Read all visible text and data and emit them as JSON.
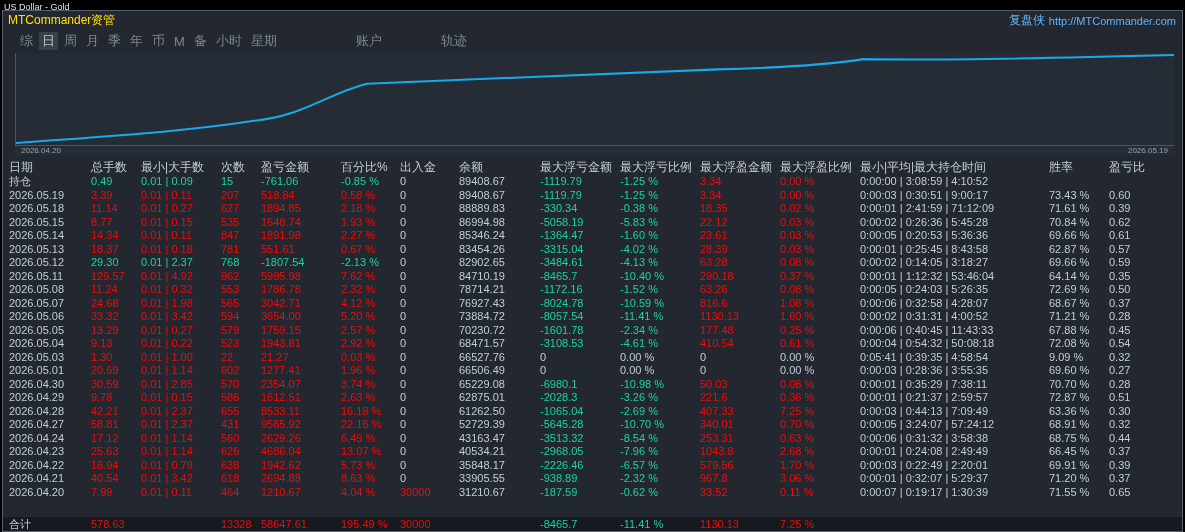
{
  "window": {
    "title": "US Dollar - Gold"
  },
  "header": {
    "brand": "MTCommander资管",
    "product": "复盘侠",
    "url": "http://MTCommander.com"
  },
  "tabs": [
    {
      "label": "综",
      "selected": false
    },
    {
      "label": "日",
      "selected": true
    },
    {
      "label": "周",
      "selected": false
    },
    {
      "label": "月",
      "selected": false
    },
    {
      "label": "季",
      "selected": false
    },
    {
      "label": "年",
      "selected": false
    },
    {
      "label": "币",
      "selected": false
    },
    {
      "label": "M",
      "selected": false
    },
    {
      "label": "备",
      "selected": false
    },
    {
      "label": "小时",
      "selected": false
    },
    {
      "label": "星期",
      "selected": false
    },
    {
      "label": "账户",
      "selected": false
    },
    {
      "label": "轨迹",
      "selected": false
    }
  ],
  "chart": {
    "start_label": "2026.04.20",
    "end_label": "2026.05.19"
  },
  "table": {
    "columns": [
      "日期",
      "总手数",
      "最小|大手数",
      "次数",
      "盈亏金额",
      "百分比%",
      "出入金",
      "余额",
      "最大浮亏金额",
      "最大浮亏比例",
      "最大浮盈金额",
      "最大浮盈比例",
      "最小|平均|最大持仓时间",
      "胜率",
      "盈亏比"
    ],
    "rows": [
      {
        "loss": true,
        "flat": false,
        "deposit": false,
        "cells": [
          "持仓",
          "0.49",
          "0.01 | 0.09",
          "15",
          "-761.06",
          "-0.85 %",
          "0",
          "89408.67",
          "-1119.79",
          "-1.25 %",
          "3.34",
          "0.00 %",
          "0:00:00 | 3:08:59 | 4:10:52"
        ]
      },
      {
        "loss": false,
        "flat": false,
        "deposit": false,
        "cells": [
          "2026.05.19",
          "3.39",
          "0.01 | 0.11",
          "207",
          "518.84",
          "0.58 %",
          "0",
          "89408.67",
          "-1119.79",
          "-1.25 %",
          "3.34",
          "0.00 %",
          "0:00:03 | 0:30:51 | 9:00:17",
          "73.43 %",
          "0.60"
        ]
      },
      {
        "loss": false,
        "flat": false,
        "deposit": false,
        "cells": [
          "2026.05.18",
          "11.14",
          "0.01 | 0.27",
          "627",
          "1894.85",
          "2.18 %",
          "0",
          "88889.83",
          "-330.34",
          "-0.38 %",
          "18.35",
          "0.02 %",
          "0:00:01 | 2:41:59 | 71:12:09",
          "71.61 %",
          "0.39"
        ]
      },
      {
        "loss": false,
        "flat": false,
        "deposit": false,
        "cells": [
          "2026.05.15",
          "8.77",
          "0.01 | 0.15",
          "535",
          "1648.74",
          "1.93 %",
          "0",
          "86994.98",
          "-5058.19",
          "-5.83 %",
          "22.12",
          "0.03 %",
          "0:00:02 | 0:26:36 | 5:45:28",
          "70.84 %",
          "0.62"
        ]
      },
      {
        "loss": false,
        "flat": false,
        "deposit": false,
        "cells": [
          "2026.05.14",
          "14.34",
          "0.01 | 0.11",
          "847",
          "1891.98",
          "2.27 %",
          "0",
          "85346.24",
          "-1364.47",
          "-1.60 %",
          "23.61",
          "0.03 %",
          "0:00:05 | 0:20:53 | 5:36:36",
          "69.66 %",
          "0.61"
        ]
      },
      {
        "loss": false,
        "flat": false,
        "deposit": false,
        "cells": [
          "2026.05.13",
          "18.37",
          "0.01 | 0.18",
          "781",
          "551.61",
          "0.67 %",
          "0",
          "83454.26",
          "-3315.04",
          "-4.02 %",
          "28.39",
          "0.03 %",
          "0:00:01 | 0:25:45 | 8:43:58",
          "62.87 %",
          "0.57"
        ]
      },
      {
        "loss": true,
        "flat": false,
        "deposit": false,
        "cells": [
          "2026.05.12",
          "29.30",
          "0.01 | 2.37",
          "768",
          "-1807.54",
          "-2.13 %",
          "0",
          "82902.65",
          "-3484.61",
          "-4.13 %",
          "63.28",
          "0.08 %",
          "0:00:02 | 0:14:05 | 3:18:27",
          "69.66 %",
          "0.59"
        ]
      },
      {
        "loss": false,
        "flat": false,
        "deposit": false,
        "cells": [
          "2026.05.11",
          "129.57",
          "0.01 | 4.92",
          "962",
          "5995.98",
          "7.62 %",
          "0",
          "84710.19",
          "-8465.7",
          "-10.40 %",
          "290.18",
          "0.37 %",
          "0:00:01 | 1:12:32 | 53:46:04",
          "64.14 %",
          "0.35"
        ]
      },
      {
        "loss": false,
        "flat": false,
        "deposit": false,
        "cells": [
          "2026.05.08",
          "11.24",
          "0.01 | 0.32",
          "553",
          "1786.78",
          "2.32 %",
          "0",
          "78714.21",
          "-1172.16",
          "-1.52 %",
          "63.26",
          "0.08 %",
          "0:00:05 | 0:24:03 | 5:26:35",
          "72.69 %",
          "0.50"
        ]
      },
      {
        "loss": false,
        "flat": false,
        "deposit": false,
        "cells": [
          "2026.05.07",
          "24.68",
          "0.01 | 1.98",
          "565",
          "3042.71",
          "4.12 %",
          "0",
          "76927.43",
          "-8024.78",
          "-10.59 %",
          "816.6",
          "1.08 %",
          "0:00:06 | 0:32:58 | 4:28:07",
          "68.67 %",
          "0.37"
        ]
      },
      {
        "loss": false,
        "flat": false,
        "deposit": false,
        "cells": [
          "2026.05.06",
          "33.32",
          "0.01 | 3.42",
          "594",
          "3654.00",
          "5.20 %",
          "0",
          "73884.72",
          "-8057.54",
          "-11.41 %",
          "1130.13",
          "1.60 %",
          "0:00:02 | 0:31:31 | 4:00:52",
          "71.21 %",
          "0.28"
        ]
      },
      {
        "loss": false,
        "flat": false,
        "deposit": false,
        "cells": [
          "2026.05.05",
          "13.29",
          "0.01 | 0.27",
          "579",
          "1759.15",
          "2.57 %",
          "0",
          "70230.72",
          "-1601.78",
          "-2.34 %",
          "177.48",
          "0.25 %",
          "0:00:06 | 0:40:45 | 11:43:33",
          "67.88 %",
          "0.45"
        ]
      },
      {
        "loss": false,
        "flat": false,
        "deposit": false,
        "cells": [
          "2026.05.04",
          "9.13",
          "0.01 | 0.22",
          "523",
          "1943.81",
          "2.92 %",
          "0",
          "68471.57",
          "-3108.53",
          "-4.61 %",
          "410.54",
          "0.61 %",
          "0:00:04 | 0:54:32 | 50:08:18",
          "72.08 %",
          "0.54"
        ]
      },
      {
        "loss": false,
        "flat": true,
        "deposit": false,
        "cells": [
          "2026.05.03",
          "1.30",
          "0.01 | 1.00",
          "22",
          "21.27",
          "0.03 %",
          "0",
          "66527.76",
          "0",
          "0.00 %",
          "0",
          "0.00 %",
          "0:05:41 | 0:39:35 | 4:58:54",
          "9.09 %",
          "0.32"
        ]
      },
      {
        "loss": false,
        "flat": true,
        "deposit": false,
        "cells": [
          "2026.05.01",
          "20.69",
          "0.01 | 1.14",
          "602",
          "1277.41",
          "1.96 %",
          "0",
          "66506.49",
          "0",
          "0.00 %",
          "0",
          "0.00 %",
          "0:00:03 | 0:28:36 | 3:55:35",
          "69.60 %",
          "0.27"
        ]
      },
      {
        "loss": false,
        "flat": false,
        "deposit": false,
        "cells": [
          "2026.04.30",
          "30.59",
          "0.01 | 2.85",
          "570",
          "2354.07",
          "3.74 %",
          "0",
          "65229.08",
          "-6980.1",
          "-10.98 %",
          "50.03",
          "0.08 %",
          "0:00:01 | 0:35:29 | 7:38:11",
          "70.70 %",
          "0.28"
        ]
      },
      {
        "loss": false,
        "flat": false,
        "deposit": false,
        "cells": [
          "2026.04.29",
          "9.78",
          "0.01 | 0.15",
          "586",
          "1612.51",
          "2.63 %",
          "0",
          "62875.01",
          "-2028.3",
          "-3.26 %",
          "221.6",
          "0.36 %",
          "0:00:01 | 0:21:37 | 2:59:57",
          "72.87 %",
          "0.51"
        ]
      },
      {
        "loss": false,
        "flat": false,
        "deposit": false,
        "cells": [
          "2026.04.28",
          "42.21",
          "0.01 | 2.37",
          "655",
          "8533.11",
          "16.18 %",
          "0",
          "61262.50",
          "-1065.04",
          "-2.69 %",
          "407.33",
          "7.25 %",
          "0:00:03 | 0:44:13 | 7:09:49",
          "63.36 %",
          "0.30"
        ]
      },
      {
        "loss": false,
        "flat": false,
        "deposit": false,
        "cells": [
          "2026.04.27",
          "58.81",
          "0.01 | 2.37",
          "431",
          "9565.92",
          "22.16 %",
          "0",
          "52729.39",
          "-5645.28",
          "-10.70 %",
          "340.01",
          "0.70 %",
          "0:00:05 | 3:24:07 | 57:24:12",
          "68.91 %",
          "0.32"
        ]
      },
      {
        "loss": false,
        "flat": false,
        "deposit": false,
        "cells": [
          "2026.04.24",
          "17.12",
          "0.01 | 1.14",
          "560",
          "2629.26",
          "6.49 %",
          "0",
          "43163.47",
          "-3513.32",
          "-8.54 %",
          "253.31",
          "0.63 %",
          "0:00:06 | 0:31:32 | 3:58:38",
          "68.75 %",
          "0.44"
        ]
      },
      {
        "loss": false,
        "flat": false,
        "deposit": false,
        "cells": [
          "2026.04.23",
          "25.63",
          "0.01 | 1.14",
          "626",
          "4686.04",
          "13.07 %",
          "0",
          "40534.21",
          "-2968.05",
          "-7.96 %",
          "1043.8",
          "2.68 %",
          "0:00:01 | 0:24:08 | 2:49:49",
          "66.45 %",
          "0.37"
        ]
      },
      {
        "loss": false,
        "flat": false,
        "deposit": false,
        "cells": [
          "2026.04.22",
          "16.94",
          "0.01 | 0.79",
          "638",
          "1942.62",
          "5.73 %",
          "0",
          "35848.17",
          "-2226.46",
          "-6.57 %",
          "579.56",
          "1.70 %",
          "0:00:03 | 0:22:49 | 2:20:01",
          "69.91 %",
          "0.39"
        ]
      },
      {
        "loss": false,
        "flat": false,
        "deposit": false,
        "cells": [
          "2026.04.21",
          "40.54",
          "0.01 | 3.42",
          "618",
          "2694.88",
          "8.63 %",
          "0",
          "33905.55",
          "-938.89",
          "-2.32 %",
          "967.8",
          "3.06 %",
          "0:00:01 | 0:32:07 | 5:29:37",
          "71.20 %",
          "0.37"
        ]
      },
      {
        "loss": false,
        "flat": false,
        "deposit": true,
        "cells": [
          "2026.04.20",
          "7.99",
          "0.01 | 0.11",
          "464",
          "1210.67",
          "4.04 %",
          "30000",
          "31210.67",
          "-187.59",
          "-0.62 %",
          "33.52",
          "0.11 %",
          "0:00:07 | 0:19:17 | 1:30:39",
          "71.55 %",
          "0.65"
        ]
      }
    ],
    "total": {
      "label": "合计",
      "lots": "578.63",
      "count": "13328",
      "pnl": "58647.61",
      "pct": "195.49 %",
      "deposit": "30000",
      "max_float_loss": "-8465.7",
      "max_float_loss_pct": "-11.41 %",
      "max_float_gain": "1130.13",
      "max_float_gain_pct": "7.25 %"
    }
  }
}
